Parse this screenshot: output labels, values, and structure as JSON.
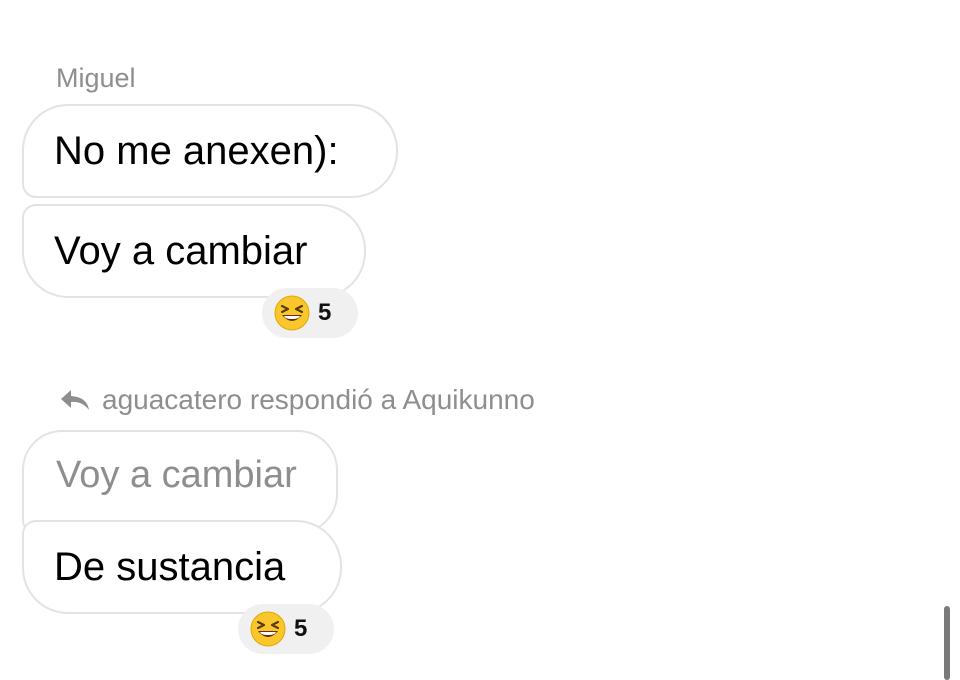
{
  "chat": {
    "sender_name": "Miguel",
    "messages": [
      {
        "text": "No me anexen):"
      },
      {
        "text": "Voy a cambiar"
      }
    ],
    "reaction_1": {
      "emoji": "grinning-squinting-face-icon",
      "count": "5"
    },
    "reply": {
      "icon": "reply-arrow-icon",
      "text": "aguacatero respondió a Aquikunno",
      "quoted_text": "Voy a cambiar",
      "message": "De sustancia"
    },
    "reaction_2": {
      "emoji": "grinning-squinting-face-icon",
      "count": "5"
    }
  },
  "colors": {
    "muted_text": "#8e8e8e",
    "bubble_border": "#e3e3e3",
    "reaction_bg": "#f0f0f0",
    "emoji_yellow": "#f9c72b"
  }
}
